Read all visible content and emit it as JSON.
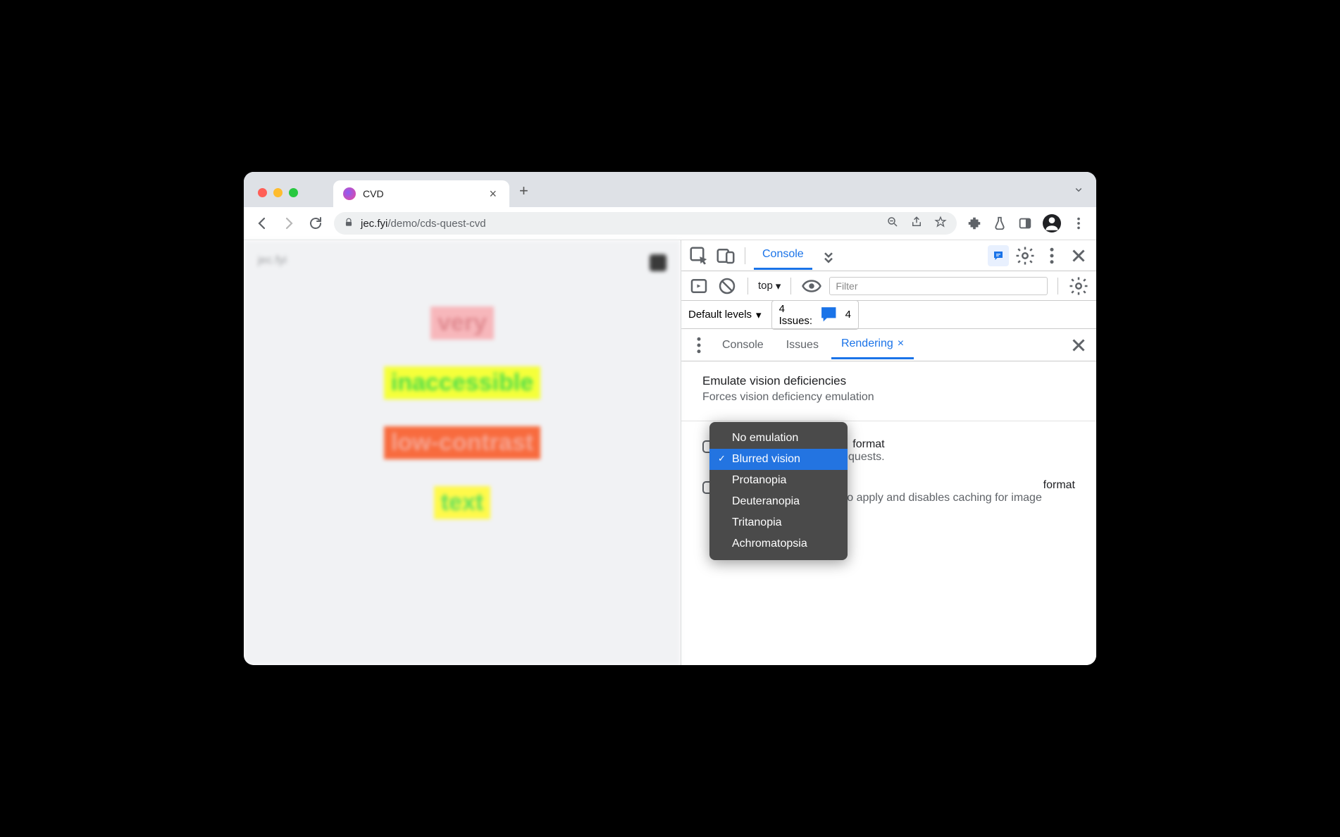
{
  "tab": {
    "title": "CVD"
  },
  "url": {
    "host": "jec.fyi",
    "path": "/demo/cds-quest-cvd"
  },
  "page": {
    "brand": "jec.fyi",
    "words": [
      "very",
      "inaccessible",
      "low-contrast",
      "text"
    ]
  },
  "devtools": {
    "main_tab": "Console",
    "context": "top",
    "filter_placeholder": "Filter",
    "levels": "Default levels",
    "issues_label": "4 Issues:",
    "issues_count": "4",
    "drawer_tabs": [
      "Console",
      "Issues",
      "Rendering"
    ],
    "rendering": {
      "section_title": "Emulate vision deficiencies",
      "section_sub": "Forces vision deficiency emulation",
      "dropdown": [
        "No emulation",
        "Blurred vision",
        "Protanopia",
        "Deuteranopia",
        "Tritanopia",
        "Achromatopsia"
      ],
      "selected": "Blurred vision",
      "opt1_title": "format",
      "opt1_body": "ad to apply and disables quests.",
      "opt2_title": "format",
      "opt2_body": "Requires a page reload to apply and disables caching for image requests."
    }
  }
}
